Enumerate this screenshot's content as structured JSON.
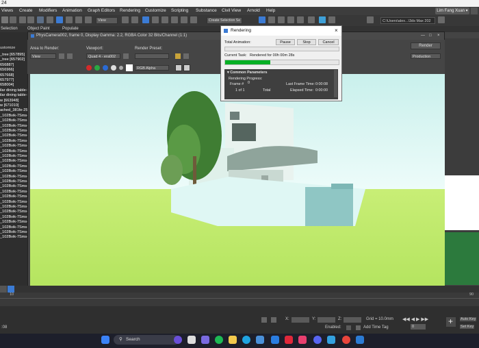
{
  "window": {
    "title_fragment": "24"
  },
  "menu": [
    "Views",
    "Create",
    "Modifiers",
    "Animation",
    "Graph Editors",
    "Rendering",
    "Customize",
    "Scripting",
    "Substance",
    "Civil View",
    "Arnold",
    "Help"
  ],
  "user": {
    "name": "Lim Fang Xuan",
    "arrow": "▾"
  },
  "toolbar": {
    "view_dropdown": "View",
    "selection_set": "Create Selection Se",
    "path": "C:\\Users\\alex...\\3ds Max 202"
  },
  "ribbon": {
    "selection": "Selection",
    "object_paint": "Object Paint",
    "populate": "Populate"
  },
  "left_panel": {
    "header": "ustomize",
    "items": [
      "_tree [657895]",
      "_tree [657902]",
      "656887]",
      "656966]",
      "657668]",
      "657977]",
      "658004]",
      "ilar dining table-Ex",
      "ilar dining table-Ex",
      "w [663948]",
      "w [671010]",
      "ached_381fe-258e6",
      "_102Bvik-7Sms-10(",
      "_102Bvik-7Sms-10(",
      "_102Bvik-7Sms-10(",
      "_102Bvik-7Sms-10(",
      "_102Bvik-7Sms-10(",
      "_102Bvik-7Sms-10(",
      "_102Bvik-7Sms-10(",
      "_102Bvik-7Sms-10(",
      "_102Bvik-7Sms-10(",
      "_102Bvik-7Sms-10(",
      "_102Bvik-7Sms-10(",
      "_102Bvik-7Sms-10(",
      "_102Bvik-7Sms-10(",
      "_102Bvik-7Sms-10(",
      "_102Bvik-7Sms-10(",
      "_102Bvik-7Sms-10(",
      "_102Bvik-7Sms-10(",
      "_102Bvik-7Sms-10(",
      "_102Bvik-7Sms-10(",
      "_102Bvik-7Sms-10(",
      "_102Bvik-7Sms-10(",
      "_102Bvik-7Sms-10(",
      "_102Bvik-7Sms-10(",
      "_102Bvik-7Sms-10(",
      "_102Bvik-7Sms-10("
    ]
  },
  "frame_window": {
    "title": "PhysCamera002, frame 0, Display Gamma: 2.2, RGBA Color 32 Bits/Channel (1:1)",
    "area_to_render_label": "Area to Render:",
    "area_to_render_value": "View",
    "viewport_label": "Viewport:",
    "viewport_value": "Quad 4 - era002",
    "render_preset_label": "Render Preset:",
    "render_preset_value": "",
    "channel_value": "RGB Alpha",
    "render_button": "Render",
    "production_value": "Production"
  },
  "rendering_dialog": {
    "title": "Rendering",
    "close_glyph": "×",
    "buttons": {
      "pause": "Pause",
      "stop": "Stop",
      "cancel": "Cancel"
    },
    "total_animation_label": "Total Animation:",
    "total_animation_progress": 0,
    "current_task_label": "Current Task:",
    "current_task_value": "Rendered for 00h 00m 28s",
    "current_task_progress": 0.4,
    "common_parameters": "Common Parameters",
    "rendering_progress": "Rendering Progress:",
    "frame_label": "Frame #",
    "frame_value": "0",
    "frame_count": "1 of 1",
    "total_label": "Total",
    "last_frame_time_label": "Last Frame Time:",
    "last_frame_time_value": "0:00:08",
    "elapsed_time_label": "Elapsed Time:",
    "elapsed_time_value": "0:00:00"
  },
  "trackbar": {
    "start": "10",
    "end": "90"
  },
  "status": {
    "x_label": "X:",
    "y_label": "Y:",
    "z_label": "Z:",
    "grid": "Grid = 10.0mm",
    "enabled_label": "Enabled:",
    "add_time_tag": "Add Time Tag",
    "auto_key": "Auto Key",
    "set_key": "Set Key",
    "frame_field": "0",
    "left_text": ":08"
  },
  "taskbar": {
    "search_placeholder": "Search"
  },
  "colors": {
    "render_green": "#06b025",
    "sky": "#d9f6f3",
    "grass": "#b9e85a",
    "taskbar": "#1d1f2b"
  }
}
